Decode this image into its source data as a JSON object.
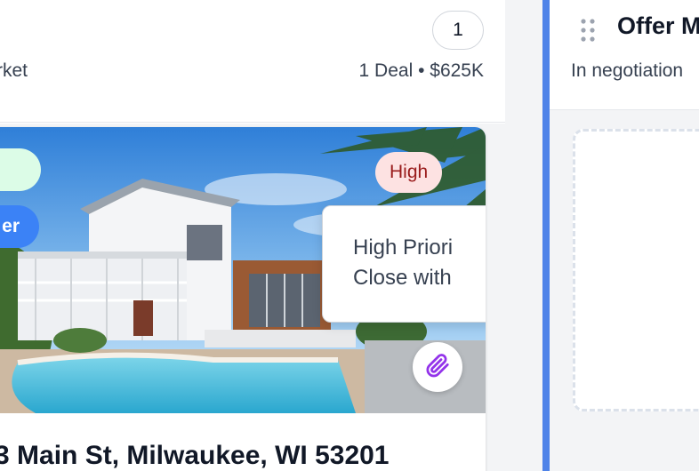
{
  "left_column": {
    "count": "1",
    "subtitle": "rket",
    "summary": "1 Deal • $625K"
  },
  "deal_card": {
    "tag_blue_label": "er",
    "priority_label": "High",
    "tooltip": {
      "line1": "High Priori",
      "line2": "Close with"
    },
    "attach_icon": "paperclip-icon",
    "address": "3 Main St, Milwaukee, WI 53201"
  },
  "right_column": {
    "drag_icon": "drag-handle-icon",
    "title": "Offer M",
    "subtitle": "In negotiation"
  },
  "colors": {
    "accent_bar": "#4f83e8",
    "tag_blue": "#3b82f6",
    "tag_green": "#dcfce7",
    "priority_bg": "#fde2e2",
    "priority_text": "#991b1b",
    "attach_icon": "#9333ea"
  }
}
